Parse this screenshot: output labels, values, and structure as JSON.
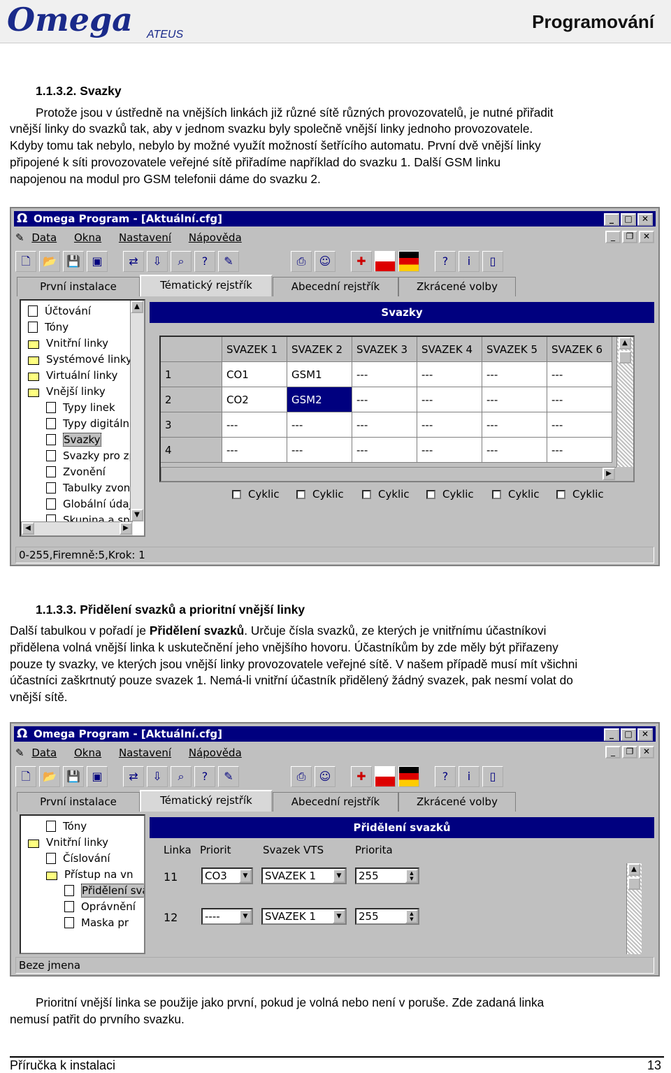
{
  "header": {
    "logo_text": "Omega",
    "logo_sub": "ATEUS",
    "title": "Programování"
  },
  "s1": {
    "heading": "1.1.3.2. Svazky",
    "l1": "Protože jsou v ústředně na vnějších linkách již různé sítě různých provozovatelů, je nutné přiřadit",
    "l2": "vnější linky do svazků tak, aby v jednom svazku byly společně vnější linky jednoho provozovatele.",
    "l3": "Kdyby tomu tak nebylo, nebylo by možné využít možností šetřícího automatu. První dvě vnější linky",
    "l4": "připojené k síti provozovatele veřejné sítě přiřadíme například do svazku 1. Další GSM linku",
    "l5": "napojenou na modul pro GSM telefonii dáme do svazku 2."
  },
  "win1": {
    "title": "Omega Program - [Aktuální.cfg]",
    "menu": [
      "Data",
      "Okna",
      "Nastavení",
      "Nápověda"
    ],
    "tabs": [
      "První instalace",
      "Tématický rejstřík",
      "Abecední rejstřík",
      "Zkrácené volby"
    ],
    "tree": [
      "Účtování",
      "Tóny",
      "Vnitřní linky",
      "Systémové linky",
      "Virtuální linky",
      "Vnější linky",
      "Typy linek",
      "Typy digitální",
      "Svazky",
      "Svazky pro zp",
      "Zvonění",
      "Tabulky zvon",
      "Globální údaj",
      "Skupina a spi"
    ],
    "panel_title": "Svazky",
    "col_headers": [
      "SVAZEK 1",
      "SVAZEK 2",
      "SVAZEK 3",
      "SVAZEK 4",
      "SVAZEK 5",
      "SVAZEK 6"
    ],
    "rows": [
      {
        "num": "1",
        "cells": [
          "CO1",
          "GSM1",
          "---",
          "---",
          "---",
          "---"
        ]
      },
      {
        "num": "2",
        "cells": [
          "CO2",
          "GSM2",
          "---",
          "---",
          "---",
          "---"
        ]
      },
      {
        "num": "3",
        "cells": [
          "---",
          "---",
          "---",
          "---",
          "---",
          "---"
        ]
      },
      {
        "num": "4",
        "cells": [
          "---",
          "---",
          "---",
          "---",
          "---",
          "---"
        ]
      }
    ],
    "checkbox_label": "Cyklic",
    "status": "0-255,Firemně:5,Krok: 1"
  },
  "s2": {
    "heading": "1.1.3.3. Přidělení svazků a prioritní vnější linky",
    "l1a": "Další tabulkou v pořadí je ",
    "l1b": "Přidělení svazků",
    "l1c": ". Určuje čísla svazků, ze kterých je vnitřnímu účastníkovi",
    "l2": "přidělena volná vnější linka k uskutečnění jeho vnějšího hovoru. Účastníkům by zde měly být přiřazeny",
    "l3": "pouze ty svazky, ve kterých jsou vnější linky provozovatele veřejné sítě. V našem případě musí mít všichni",
    "l4": "účastníci zaškrtnutý pouze svazek 1. Nemá-li vnitřní účastník přidělený žádný svazek, pak nesmí volat do",
    "l5": "vnější sítě."
  },
  "win2": {
    "title": "Omega Program - [Aktuální.cfg]",
    "menu": [
      "Data",
      "Okna",
      "Nastavení",
      "Nápověda"
    ],
    "tabs": [
      "První instalace",
      "Tématický rejstřík",
      "Abecední rejstřík",
      "Zkrácené volby"
    ],
    "tree": [
      "Tóny",
      "Vnitřní linky",
      "Číslování",
      "Přístup na vn",
      "Přidělení svazků a prioritní",
      "Oprávnění",
      "Maska pr"
    ],
    "panel_title": "Přidělení svazků",
    "col_headers": [
      "Linka",
      "Priorit",
      "Svazek VTS",
      "Priorita"
    ],
    "rows": [
      {
        "linka": "11",
        "priorit": "CO3",
        "svazek": "SVAZEK 1",
        "priorita": "255"
      },
      {
        "linka": "12",
        "priorit": "----",
        "svazek": "SVAZEK 1",
        "priorita": "255"
      }
    ],
    "status": "Beze jmena"
  },
  "s3": {
    "l1": "Prioritní vnější linka se použije jako první, pokud je volná nebo není v poruše. Zde zadaná linka",
    "l2": "nemusí patřit do prvního svazku."
  },
  "footer": {
    "left": "Příručka k instalaci",
    "right": "13"
  }
}
